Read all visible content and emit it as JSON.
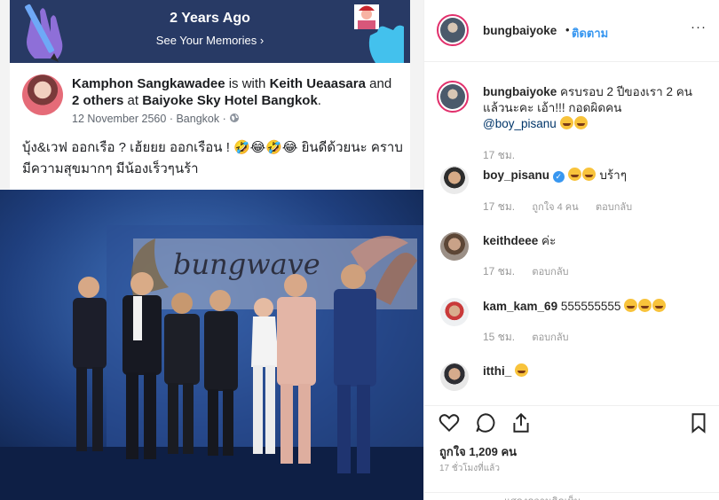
{
  "memory": {
    "title": "2 Years Ago",
    "subtitle": "See Your Memories ›"
  },
  "fb_post": {
    "author": "Kamphon Sangkawadee",
    "with_text": " is with ",
    "tagged": "Keith Ueaasara",
    "and_text": " and ",
    "others": "2 others",
    "at_text": " at ",
    "place": "Baiyoke Sky Hotel Bangkok",
    "period": ".",
    "date": "12 November 2560",
    "location": "Bangkok",
    "privacy_sep": "·",
    "text": "บุ้ง&เวฟ ออกเรือ ? เฮ้ยยย ออกเรือน ! 🤣😂🤣😂 ยินดีด้วยนะ คราบมีความสุขมากๆ มีน้องเร็วๆนร้า"
  },
  "photo": {
    "sign_text": "bungwave"
  },
  "instagram": {
    "header": {
      "username": "bungbaiyoke",
      "dot": "•",
      "follow": "ติดตาม",
      "more": "···"
    },
    "caption": {
      "username": "bungbaiyoke",
      "text": "ครบรอบ 2 ปีของเรา 2 คน แล้วนะคะ เอ้า!!! กอดผิดคน",
      "mention": "@boy_pisanu",
      "time": "17 ชม."
    },
    "comments": [
      {
        "username": "boy_pisanu",
        "text": "บร้าๆ",
        "time": "17 ชม.",
        "likes": "ถูกใจ 4 คน",
        "reply": "ตอบกลับ"
      },
      {
        "username": "keithdeee",
        "text": "ค่ะ",
        "time": "17 ชม.",
        "reply": "ตอบกลับ"
      },
      {
        "username": "kam_kam_69",
        "text": "555555555",
        "time": "15 ชม.",
        "reply": "ตอบกลับ"
      },
      {
        "username": "itthi_",
        "text": ""
      }
    ],
    "likes": "ถูกใจ 1,209 คน",
    "posted": "17 ชั่วโมงที่แล้ว",
    "add_comment": "แสดงความคิดเห็น..."
  },
  "colors": {
    "fb_banner": "#283a65",
    "link": "#3897f0",
    "ig_text": "#262626",
    "muted": "#999999",
    "photo_bg": "#1f3f7e"
  },
  "icons": [
    "pencil-icon",
    "hand-icon",
    "globe-icon",
    "verified-icon",
    "heart-icon",
    "comment-icon",
    "share-icon",
    "bookmark-icon",
    "more-icon"
  ]
}
